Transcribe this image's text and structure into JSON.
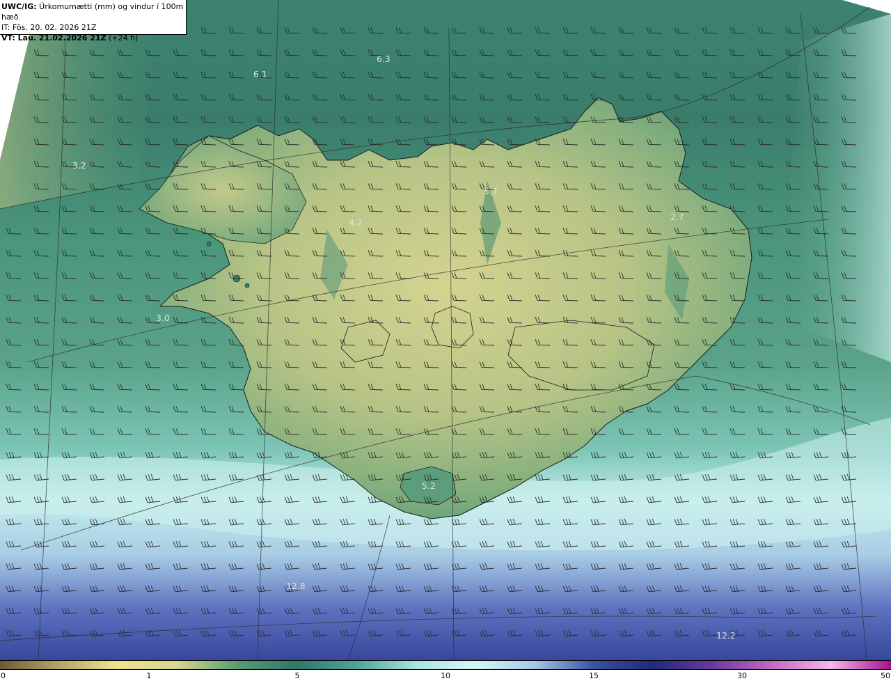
{
  "header": {
    "line1_bold": "UWC/IG:",
    "line1_text": " Úrkomumætti (mm) og vindur í 100m hæð",
    "line2_text": "IT: Fös. 20. 02. 2026 21Z",
    "line3_bold": "VT: Lau. 21.02.2026 21Z",
    "line3_text": " (+24 h)"
  },
  "value_labels": [
    "6.3",
    "6.1",
    "3.2",
    "5.7",
    "4.2",
    "2.7",
    "3.0",
    "5.2",
    "12.8",
    "12.2"
  ],
  "colorbar": {
    "ticks": [
      "0",
      "1",
      "5",
      "10",
      "15",
      "30",
      "50"
    ],
    "stops": [
      "#6b5a3c",
      "#b8a566",
      "#ece58e",
      "#d6d58c",
      "#5a9b75",
      "#2f7868",
      "#4fa496",
      "#a8e3df",
      "#d7f6f4",
      "#a8c7e6",
      "#3c4fa0",
      "#1f2a7a",
      "#6b3a9c",
      "#c46ac3",
      "#f0b8ea",
      "#a70f8f"
    ]
  },
  "colors": {
    "ocean_north": "#3a7d6b",
    "ocean_south": "#d3f2f1",
    "ocean_deep_south": "#3b4aa0",
    "land_high": "#cfd08a",
    "land_low": "#67a27c"
  }
}
